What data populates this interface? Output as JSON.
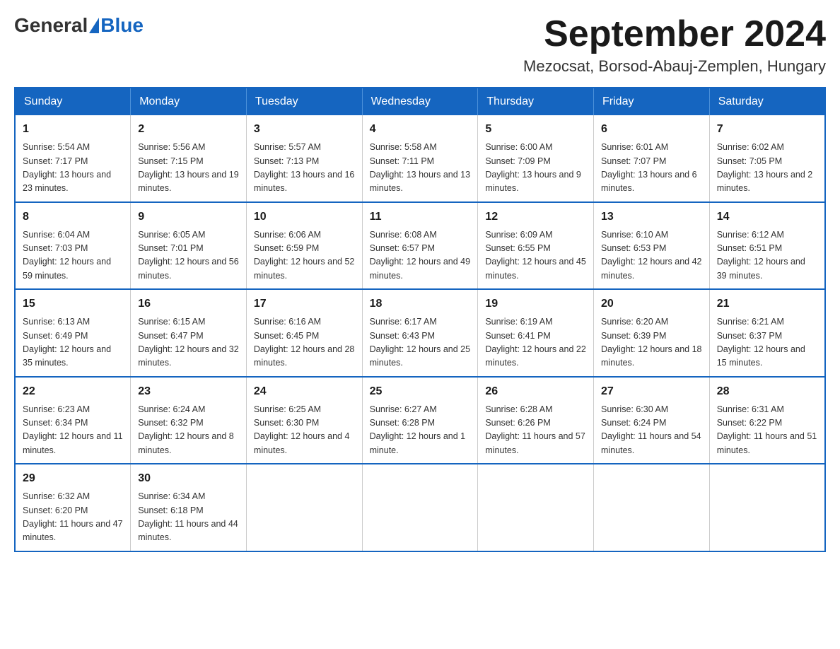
{
  "header": {
    "logo": {
      "general": "General",
      "blue": "Blue"
    },
    "title": "September 2024",
    "location": "Mezocsat, Borsod-Abauj-Zemplen, Hungary"
  },
  "weekdays": [
    "Sunday",
    "Monday",
    "Tuesday",
    "Wednesday",
    "Thursday",
    "Friday",
    "Saturday"
  ],
  "weeks": [
    [
      {
        "day": "1",
        "sunrise": "Sunrise: 5:54 AM",
        "sunset": "Sunset: 7:17 PM",
        "daylight": "Daylight: 13 hours and 23 minutes."
      },
      {
        "day": "2",
        "sunrise": "Sunrise: 5:56 AM",
        "sunset": "Sunset: 7:15 PM",
        "daylight": "Daylight: 13 hours and 19 minutes."
      },
      {
        "day": "3",
        "sunrise": "Sunrise: 5:57 AM",
        "sunset": "Sunset: 7:13 PM",
        "daylight": "Daylight: 13 hours and 16 minutes."
      },
      {
        "day": "4",
        "sunrise": "Sunrise: 5:58 AM",
        "sunset": "Sunset: 7:11 PM",
        "daylight": "Daylight: 13 hours and 13 minutes."
      },
      {
        "day": "5",
        "sunrise": "Sunrise: 6:00 AM",
        "sunset": "Sunset: 7:09 PM",
        "daylight": "Daylight: 13 hours and 9 minutes."
      },
      {
        "day": "6",
        "sunrise": "Sunrise: 6:01 AM",
        "sunset": "Sunset: 7:07 PM",
        "daylight": "Daylight: 13 hours and 6 minutes."
      },
      {
        "day": "7",
        "sunrise": "Sunrise: 6:02 AM",
        "sunset": "Sunset: 7:05 PM",
        "daylight": "Daylight: 13 hours and 2 minutes."
      }
    ],
    [
      {
        "day": "8",
        "sunrise": "Sunrise: 6:04 AM",
        "sunset": "Sunset: 7:03 PM",
        "daylight": "Daylight: 12 hours and 59 minutes."
      },
      {
        "day": "9",
        "sunrise": "Sunrise: 6:05 AM",
        "sunset": "Sunset: 7:01 PM",
        "daylight": "Daylight: 12 hours and 56 minutes."
      },
      {
        "day": "10",
        "sunrise": "Sunrise: 6:06 AM",
        "sunset": "Sunset: 6:59 PM",
        "daylight": "Daylight: 12 hours and 52 minutes."
      },
      {
        "day": "11",
        "sunrise": "Sunrise: 6:08 AM",
        "sunset": "Sunset: 6:57 PM",
        "daylight": "Daylight: 12 hours and 49 minutes."
      },
      {
        "day": "12",
        "sunrise": "Sunrise: 6:09 AM",
        "sunset": "Sunset: 6:55 PM",
        "daylight": "Daylight: 12 hours and 45 minutes."
      },
      {
        "day": "13",
        "sunrise": "Sunrise: 6:10 AM",
        "sunset": "Sunset: 6:53 PM",
        "daylight": "Daylight: 12 hours and 42 minutes."
      },
      {
        "day": "14",
        "sunrise": "Sunrise: 6:12 AM",
        "sunset": "Sunset: 6:51 PM",
        "daylight": "Daylight: 12 hours and 39 minutes."
      }
    ],
    [
      {
        "day": "15",
        "sunrise": "Sunrise: 6:13 AM",
        "sunset": "Sunset: 6:49 PM",
        "daylight": "Daylight: 12 hours and 35 minutes."
      },
      {
        "day": "16",
        "sunrise": "Sunrise: 6:15 AM",
        "sunset": "Sunset: 6:47 PM",
        "daylight": "Daylight: 12 hours and 32 minutes."
      },
      {
        "day": "17",
        "sunrise": "Sunrise: 6:16 AM",
        "sunset": "Sunset: 6:45 PM",
        "daylight": "Daylight: 12 hours and 28 minutes."
      },
      {
        "day": "18",
        "sunrise": "Sunrise: 6:17 AM",
        "sunset": "Sunset: 6:43 PM",
        "daylight": "Daylight: 12 hours and 25 minutes."
      },
      {
        "day": "19",
        "sunrise": "Sunrise: 6:19 AM",
        "sunset": "Sunset: 6:41 PM",
        "daylight": "Daylight: 12 hours and 22 minutes."
      },
      {
        "day": "20",
        "sunrise": "Sunrise: 6:20 AM",
        "sunset": "Sunset: 6:39 PM",
        "daylight": "Daylight: 12 hours and 18 minutes."
      },
      {
        "day": "21",
        "sunrise": "Sunrise: 6:21 AM",
        "sunset": "Sunset: 6:37 PM",
        "daylight": "Daylight: 12 hours and 15 minutes."
      }
    ],
    [
      {
        "day": "22",
        "sunrise": "Sunrise: 6:23 AM",
        "sunset": "Sunset: 6:34 PM",
        "daylight": "Daylight: 12 hours and 11 minutes."
      },
      {
        "day": "23",
        "sunrise": "Sunrise: 6:24 AM",
        "sunset": "Sunset: 6:32 PM",
        "daylight": "Daylight: 12 hours and 8 minutes."
      },
      {
        "day": "24",
        "sunrise": "Sunrise: 6:25 AM",
        "sunset": "Sunset: 6:30 PM",
        "daylight": "Daylight: 12 hours and 4 minutes."
      },
      {
        "day": "25",
        "sunrise": "Sunrise: 6:27 AM",
        "sunset": "Sunset: 6:28 PM",
        "daylight": "Daylight: 12 hours and 1 minute."
      },
      {
        "day": "26",
        "sunrise": "Sunrise: 6:28 AM",
        "sunset": "Sunset: 6:26 PM",
        "daylight": "Daylight: 11 hours and 57 minutes."
      },
      {
        "day": "27",
        "sunrise": "Sunrise: 6:30 AM",
        "sunset": "Sunset: 6:24 PM",
        "daylight": "Daylight: 11 hours and 54 minutes."
      },
      {
        "day": "28",
        "sunrise": "Sunrise: 6:31 AM",
        "sunset": "Sunset: 6:22 PM",
        "daylight": "Daylight: 11 hours and 51 minutes."
      }
    ],
    [
      {
        "day": "29",
        "sunrise": "Sunrise: 6:32 AM",
        "sunset": "Sunset: 6:20 PM",
        "daylight": "Daylight: 11 hours and 47 minutes."
      },
      {
        "day": "30",
        "sunrise": "Sunrise: 6:34 AM",
        "sunset": "Sunset: 6:18 PM",
        "daylight": "Daylight: 11 hours and 44 minutes."
      },
      null,
      null,
      null,
      null,
      null
    ]
  ]
}
